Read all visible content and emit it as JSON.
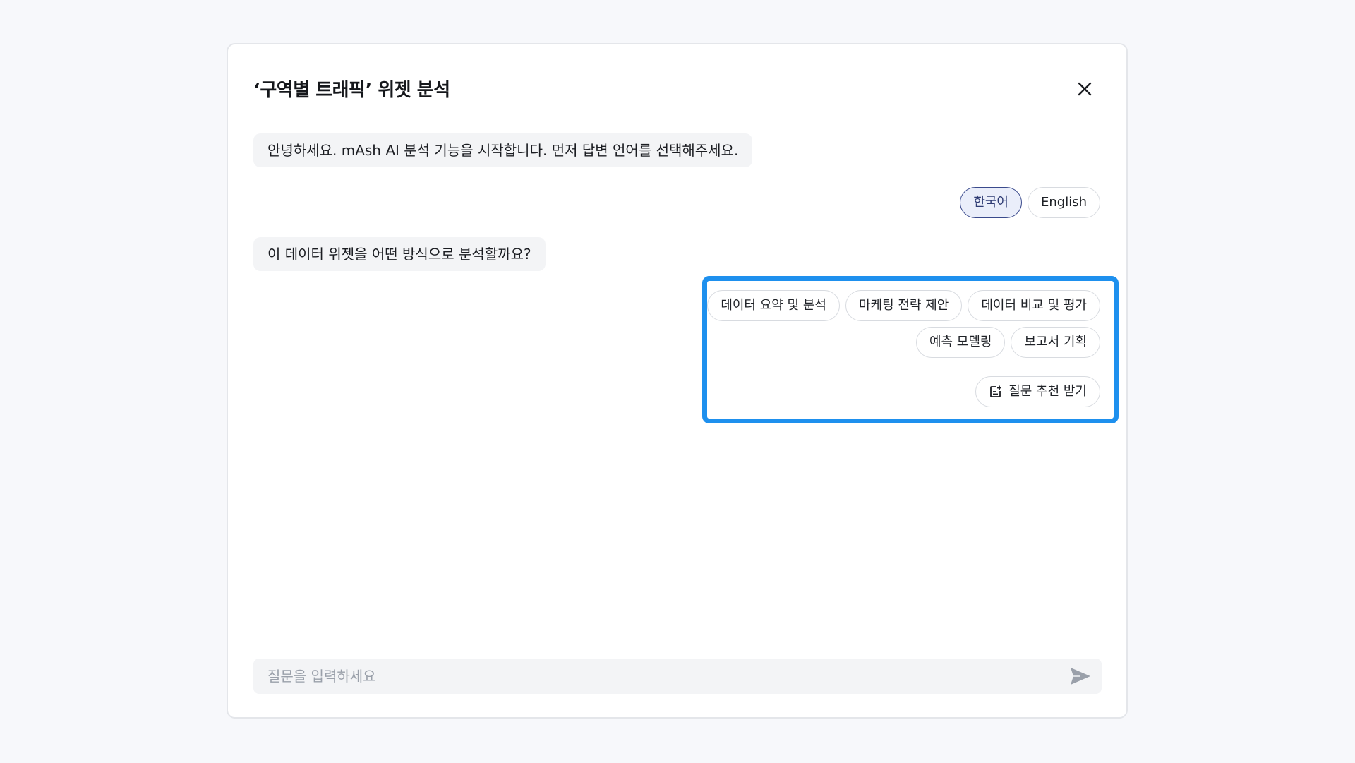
{
  "dialog": {
    "title": "‘구역별 트래픽’ 위젯 분석"
  },
  "messages": {
    "greeting": "안녕하세요. mAsh AI 분석 기능을 시작합니다. 먼저 답변 언어를 선택해주세요.",
    "question": "이 데이터 위젯을 어떤 방식으로 분석할까요?"
  },
  "languages": {
    "korean": "한국어",
    "english": "English",
    "selected": "한국어"
  },
  "analysis_options": [
    "데이터 요약 및 분석",
    "마케팅 전략 제안",
    "데이터 비교 및 평가",
    "예측 모델링",
    "보고서 기획"
  ],
  "suggest": {
    "label": "질문 추천 받기",
    "icon": "add-note-icon"
  },
  "input": {
    "placeholder": "질문을 입력하세요",
    "value": ""
  },
  "colors": {
    "highlight": "#1e90ee",
    "active_chip_border": "#3a4a8c",
    "active_chip_bg": "#eaeefa"
  }
}
